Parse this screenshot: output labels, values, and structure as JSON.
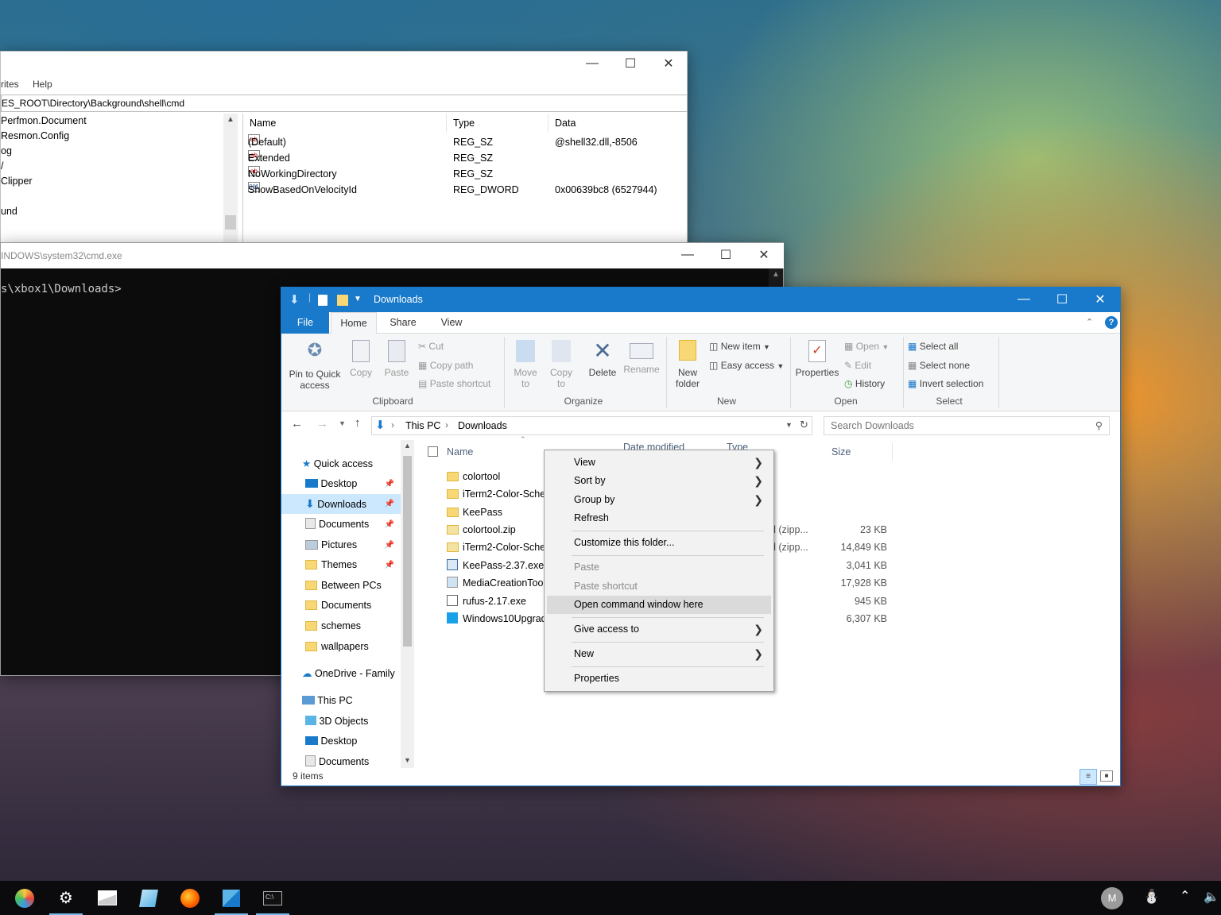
{
  "regedit": {
    "menu": [
      "rites",
      "Help"
    ],
    "address": "ES_ROOT\\Directory\\Background\\shell\\cmd",
    "tree": [
      "Perfmon.Document",
      "Resmon.Config",
      "og",
      "/",
      "Clipper",
      "",
      "und"
    ],
    "columns": [
      "Name",
      "Type",
      "Data"
    ],
    "values": [
      {
        "name": "(Default)",
        "type": "REG_SZ",
        "data": "@shell32.dll,-8506",
        "icon": "ab"
      },
      {
        "name": "Extended",
        "type": "REG_SZ",
        "data": "",
        "icon": "ab"
      },
      {
        "name": "NoWorkingDirectory",
        "type": "REG_SZ",
        "data": "",
        "icon": "ab"
      },
      {
        "name": "ShowBasedOnVelocityId",
        "type": "REG_DWORD",
        "data": "0x00639bc8 (6527944)",
        "icon": "011"
      }
    ]
  },
  "cmd": {
    "title": "INDOWS\\system32\\cmd.exe",
    "prompt": "s\\xbox1\\Downloads>"
  },
  "explorer": {
    "title": "Downloads",
    "tabs": {
      "file": "File",
      "home": "Home",
      "share": "Share",
      "view": "View"
    },
    "ribbon": {
      "pin": "Pin to Quick access",
      "copy": "Copy",
      "paste": "Paste",
      "cut": "Cut",
      "copy_path": "Copy path",
      "paste_shortcut": "Paste shortcut",
      "clipboard": "Clipboard",
      "move_to": "Move to",
      "copy_to": "Copy to",
      "delete": "Delete",
      "rename": "Rename",
      "organize": "Organize",
      "new_folder": "New folder",
      "new_item": "New item",
      "easy_access": "Easy access",
      "new": "New",
      "properties": "Properties",
      "open": "Open",
      "edit": "Edit",
      "history": "History",
      "open_group": "Open",
      "select_all": "Select all",
      "select_none": "Select none",
      "invert_selection": "Invert selection",
      "select": "Select"
    },
    "breadcrumb": [
      "This PC",
      "Downloads"
    ],
    "search_placeholder": "Search Downloads",
    "nav": [
      {
        "label": "Quick access",
        "pinned": false
      },
      {
        "label": "Desktop",
        "pinned": true
      },
      {
        "label": "Downloads",
        "pinned": true,
        "selected": true
      },
      {
        "label": "Documents",
        "pinned": true
      },
      {
        "label": "Pictures",
        "pinned": true
      },
      {
        "label": "Themes",
        "pinned": true
      },
      {
        "label": "Between PCs",
        "pinned": false
      },
      {
        "label": "Documents",
        "pinned": false
      },
      {
        "label": "schemes",
        "pinned": false
      },
      {
        "label": "wallpapers",
        "pinned": false
      },
      {
        "label": "OneDrive - Family",
        "pinned": false
      },
      {
        "label": "This PC",
        "pinned": false
      },
      {
        "label": "3D Objects",
        "pinned": false
      },
      {
        "label": "Desktop",
        "pinned": false
      },
      {
        "label": "Documents",
        "pinned": false
      }
    ],
    "columns": {
      "name": "Name",
      "date": "Date modified",
      "type": "Type",
      "size": "Size"
    },
    "files": [
      {
        "name": "colortool",
        "kind": "folder",
        "type": "",
        "size": ""
      },
      {
        "name": "iTerm2-Color-Sche",
        "kind": "folder",
        "type": "",
        "size": ""
      },
      {
        "name": "KeePass",
        "kind": "folder",
        "type": "",
        "size": ""
      },
      {
        "name": "colortool.zip",
        "kind": "zip",
        "type": "ed (zipp...",
        "size": "23 KB"
      },
      {
        "name": "iTerm2-Color-Sche",
        "kind": "zip",
        "type": "ed (zipp...",
        "size": "14,849 KB"
      },
      {
        "name": "KeePass-2.37.exe",
        "kind": "exe",
        "type": "n",
        "size": "3,041 KB"
      },
      {
        "name": "MediaCreationToo",
        "kind": "exe",
        "type": "n",
        "size": "17,928 KB"
      },
      {
        "name": "rufus-2.17.exe",
        "kind": "exe",
        "type": "n",
        "size": "945 KB"
      },
      {
        "name": "Windows10Upgrad",
        "kind": "exe",
        "type": "n",
        "size": "6,307 KB"
      }
    ],
    "status": "9 items"
  },
  "context_menu": {
    "items": [
      {
        "label": "View",
        "submenu": true
      },
      {
        "label": "Sort by",
        "submenu": true
      },
      {
        "label": "Group by",
        "submenu": true
      },
      {
        "label": "Refresh",
        "submenu": false
      },
      {
        "label": "Customize this folder...",
        "submenu": false
      },
      {
        "label": "Paste",
        "submenu": false,
        "disabled": true
      },
      {
        "label": "Paste shortcut",
        "submenu": false,
        "disabled": true
      },
      {
        "label": "Open command window here",
        "submenu": false,
        "highlighted": true
      },
      {
        "label": "Give access to",
        "submenu": true
      },
      {
        "label": "New",
        "submenu": true
      },
      {
        "label": "Properties",
        "submenu": false
      }
    ]
  },
  "taskbar": {
    "icons": [
      "paint-icon",
      "settings-icon",
      "photos-icon",
      "notepad-icon",
      "firefox-icon",
      "registry-editor-icon",
      "command-prompt-icon"
    ],
    "avatar_letter": "M"
  },
  "colors": {
    "explorer_accent": "#1979ca",
    "selection": "#cce8ff"
  }
}
